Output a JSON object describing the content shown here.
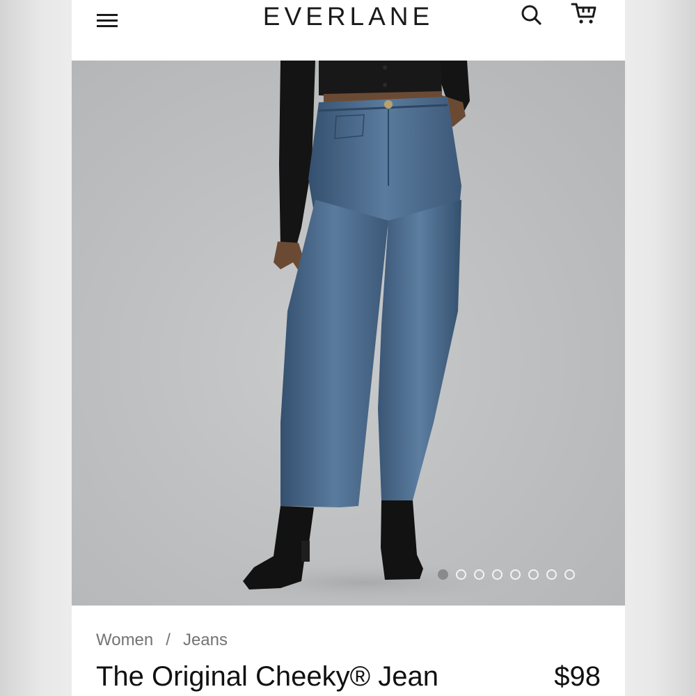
{
  "header": {
    "logo": "EVERLANE",
    "menu_icon": "hamburger-menu-icon",
    "search_icon": "search-icon",
    "cart_icon": "cart-icon"
  },
  "gallery": {
    "image_alt": "Model wearing The Original Cheeky Jean with black ankle boots",
    "slide_count": 8,
    "active_slide": 1
  },
  "breadcrumb": {
    "items": [
      "Women",
      "Jeans"
    ],
    "separator": "/"
  },
  "product": {
    "title": "The Original Cheeky® Jean",
    "price": "$98"
  },
  "colors": {
    "text": "#111111",
    "muted": "#737373",
    "denim": "#4a6a8e"
  }
}
